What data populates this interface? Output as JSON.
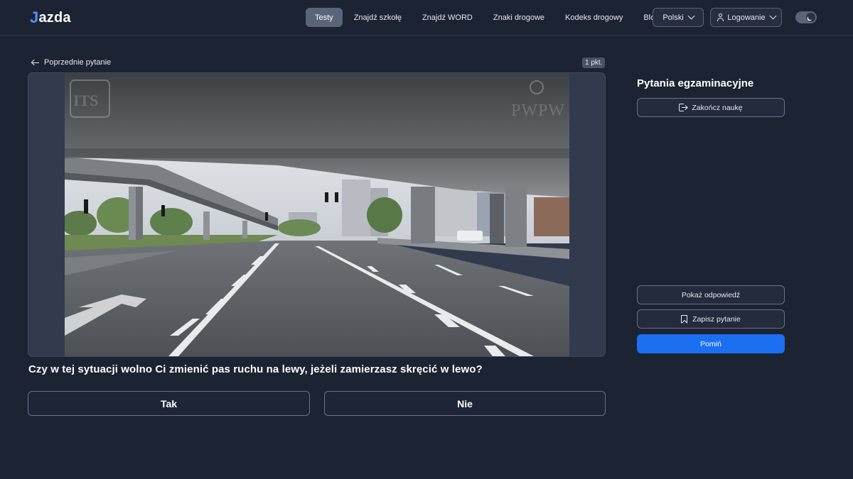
{
  "header": {
    "logo": {
      "icon": "J",
      "text": "azda"
    },
    "nav": [
      {
        "label": "Testy",
        "active": true
      },
      {
        "label": "Znajdź szkołę"
      },
      {
        "label": "Znajdź WORD"
      },
      {
        "label": "Znaki drogowe"
      },
      {
        "label": "Kodeks drogowy"
      },
      {
        "label": "Blog"
      }
    ],
    "language": "Polski",
    "login": "Logowanie",
    "theme_toggle_icon": "moon-icon"
  },
  "question": {
    "prev_label": "Poprzednie pytanie",
    "points": "1 pkt.",
    "watermark_left": "ITS",
    "watermark_right": "PWPW",
    "text": "Czy w tej sytuacji wolno Ci zmienić pas ruchu na lewy, jeżeli zamierzasz skręcić w lewo?",
    "answers": {
      "yes": "Tak",
      "no": "Nie"
    }
  },
  "sidebar": {
    "title": "Pytania egzaminacyjne",
    "end_label": "Zakończ naukę",
    "show_answer_label": "Pokaż odpowiedź",
    "save_label": "Zapisz pytanie",
    "skip_label": "Pomiń"
  },
  "colors": {
    "background": "#1c2333",
    "accent": "#1d6ff2",
    "nav_active": "#5b6579"
  }
}
